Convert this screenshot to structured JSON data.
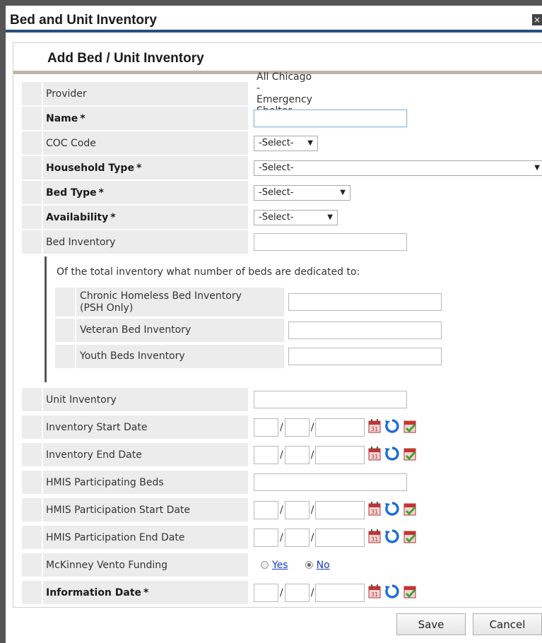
{
  "dialog": {
    "title": "Bed and Unit Inventory"
  },
  "panel": {
    "title": "Add Bed / Unit Inventory"
  },
  "fields": {
    "provider": {
      "label": "Provider",
      "value": "All Chicago - Emergency Shelter"
    },
    "name": {
      "label": "Name",
      "value": ""
    },
    "coc_code": {
      "label": "COC Code",
      "selected": "-Select-"
    },
    "household_type": {
      "label": "Household Type",
      "selected": "-Select-"
    },
    "bed_type": {
      "label": "Bed Type",
      "selected": "-Select-"
    },
    "availability": {
      "label": "Availability",
      "selected": "-Select-"
    },
    "bed_inventory": {
      "label": "Bed Inventory",
      "value": ""
    },
    "dedicated": {
      "intro": "Of the total inventory what number of beds are dedicated to:",
      "chronic": {
        "label_line1": "Chronic Homeless Bed Inventory",
        "label_line2": "(PSH Only)"
      },
      "veteran": {
        "label": "Veteran Bed Inventory"
      },
      "youth": {
        "label": "Youth Beds Inventory"
      }
    },
    "unit_inventory": {
      "label": "Unit Inventory"
    },
    "inventory_start_date": {
      "label": "Inventory Start Date"
    },
    "inventory_end_date": {
      "label": "Inventory End Date"
    },
    "hmis_participating_beds": {
      "label": "HMIS Participating Beds"
    },
    "hmis_participation_start_date": {
      "label": "HMIS Participation Start Date"
    },
    "hmis_participation_end_date": {
      "label": "HMIS Participation End Date"
    },
    "mckinney_vento_funding": {
      "label": "McKinney Vento Funding",
      "yes": "Yes",
      "no": "No",
      "selected": "No"
    },
    "information_date": {
      "label": "Information Date"
    }
  },
  "required_marker": "*",
  "slash": "/",
  "buttons": {
    "save": "Save",
    "cancel": "Cancel",
    "close": "×"
  },
  "icons": {
    "calendar": "calendar-icon",
    "refresh": "refresh-icon",
    "today": "calendar-check-icon"
  },
  "colors": {
    "title_rule": "#2b4f7e",
    "header_rule": "#bfb2a4",
    "label_bg": "#ececec",
    "link": "#1a3fbf"
  }
}
